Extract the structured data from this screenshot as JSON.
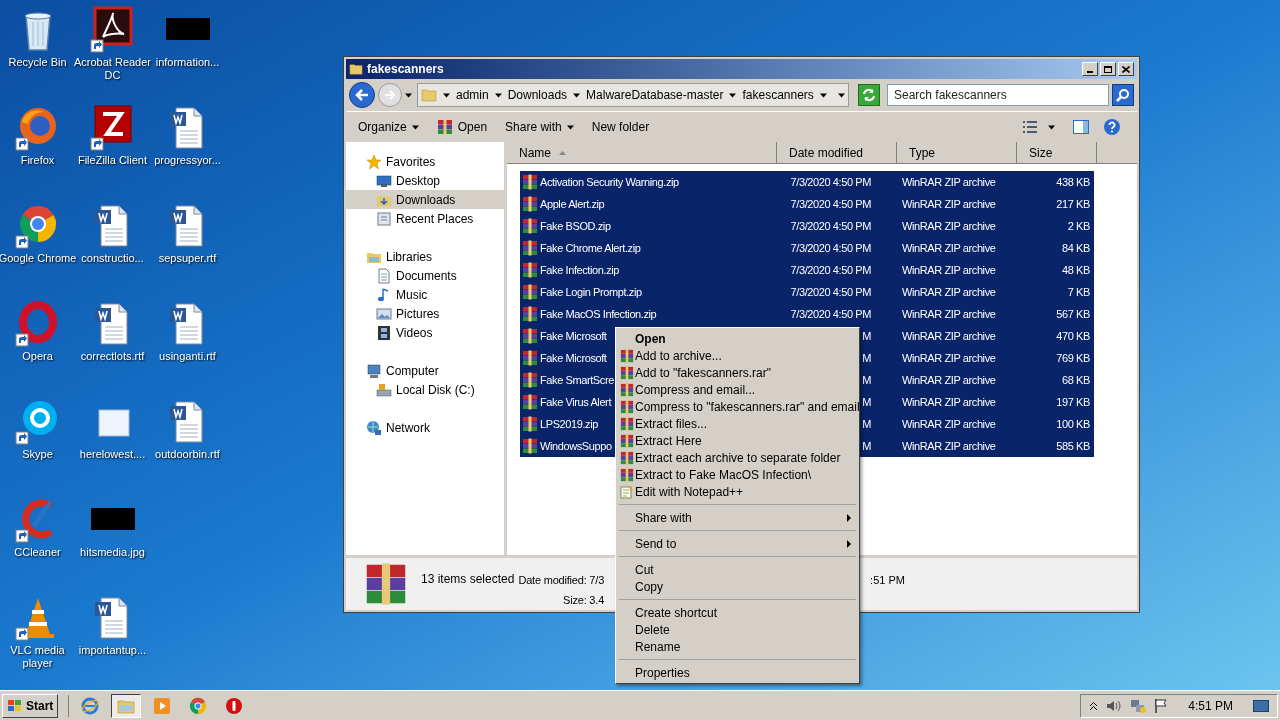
{
  "desktop": {
    "icons": [
      {
        "label": "Recycle Bin",
        "kind": "recycle",
        "shortcut": false
      },
      {
        "label": "Firefox",
        "kind": "firefox",
        "shortcut": true
      },
      {
        "label": "Google Chrome",
        "kind": "chrome",
        "shortcut": true
      },
      {
        "label": "Opera",
        "kind": "opera",
        "shortcut": true
      },
      {
        "label": "Skype",
        "kind": "skype",
        "shortcut": true
      },
      {
        "label": "CCleaner",
        "kind": "ccleaner",
        "shortcut": true
      },
      {
        "label": "VLC media player",
        "kind": "vlc",
        "shortcut": true
      },
      {
        "label": "Acrobat Reader DC",
        "kind": "acrobat",
        "shortcut": true
      },
      {
        "label": "FileZilla Client",
        "kind": "filezilla",
        "shortcut": true
      },
      {
        "label": "constructio...",
        "kind": "word",
        "shortcut": false
      },
      {
        "label": "correctlots.rtf",
        "kind": "word",
        "shortcut": false
      },
      {
        "label": "herelowest....",
        "kind": "blank",
        "shortcut": false
      },
      {
        "label": "hitsmedia.jpg",
        "kind": "black",
        "shortcut": false
      },
      {
        "label": "importantup...",
        "kind": "word",
        "shortcut": false
      },
      {
        "label": "information...",
        "kind": "black",
        "shortcut": false
      },
      {
        "label": "progressyor...",
        "kind": "word",
        "shortcut": false
      },
      {
        "label": "sepsuper.rtf",
        "kind": "word",
        "shortcut": false
      },
      {
        "label": "usinganti.rtf",
        "kind": "word",
        "shortcut": false
      },
      {
        "label": "outdoorbin.rtf",
        "kind": "word",
        "shortcut": false
      }
    ]
  },
  "window": {
    "title": "fakescanners",
    "breadcrumb": [
      "admin",
      "Downloads",
      "MalwareDatabase-master",
      "fakescanners"
    ],
    "search": {
      "placeholder": "Search fakescanners"
    },
    "toolbar": [
      {
        "label": "Organize",
        "kind": "menu"
      },
      {
        "label": "Open",
        "kind": "archive"
      },
      {
        "label": "Share with",
        "kind": "menu"
      },
      {
        "label": "New folder",
        "kind": "plain"
      }
    ],
    "nav": [
      {
        "label": "Favorites",
        "kind": "star",
        "selected": false,
        "children": [
          {
            "label": "Desktop",
            "kind": "desktop",
            "selected": false
          },
          {
            "label": "Downloads",
            "kind": "downloads",
            "selected": true
          },
          {
            "label": "Recent Places",
            "kind": "recent",
            "selected": false
          }
        ]
      },
      {
        "label": "Libraries",
        "kind": "library",
        "selected": false,
        "children": [
          {
            "label": "Documents",
            "kind": "documents",
            "selected": false
          },
          {
            "label": "Music",
            "kind": "music",
            "selected": false
          },
          {
            "label": "Pictures",
            "kind": "pictures",
            "selected": false
          },
          {
            "label": "Videos",
            "kind": "videos",
            "selected": false
          }
        ]
      },
      {
        "label": "Computer",
        "kind": "computer",
        "selected": false,
        "children": [
          {
            "label": "Local Disk (C:)",
            "kind": "disk",
            "selected": false
          }
        ]
      },
      {
        "label": "Network",
        "kind": "network",
        "selected": false
      }
    ],
    "columns": [
      {
        "label": "Name",
        "sorted": true
      },
      {
        "label": "Date modified",
        "sorted": false
      },
      {
        "label": "Type",
        "sorted": false
      },
      {
        "label": "Size",
        "sorted": false
      }
    ],
    "files": [
      {
        "name": "Activation Security Warning.zip",
        "date": "7/3/2020 4:50 PM",
        "type": "WinRAR ZIP archive",
        "size": "438 KB",
        "selected": true
      },
      {
        "name": "Apple Alert.zip",
        "date": "7/3/2020 4:50 PM",
        "type": "WinRAR ZIP archive",
        "size": "217 KB",
        "selected": true
      },
      {
        "name": "Fake BSOD.zip",
        "date": "7/3/2020 4:50 PM",
        "type": "WinRAR ZIP archive",
        "size": "2 KB",
        "selected": true
      },
      {
        "name": "Fake Chrome Alert.zip",
        "date": "7/3/2020 4:50 PM",
        "type": "WinRAR ZIP archive",
        "size": "84 KB",
        "selected": true
      },
      {
        "name": "Fake Infection.zip",
        "date": "7/3/2020 4:50 PM",
        "type": "WinRAR ZIP archive",
        "size": "48 KB",
        "selected": true
      },
      {
        "name": "Fake Login Prompt.zip",
        "date": "7/3/2020 4:50 PM",
        "type": "WinRAR ZIP archive",
        "size": "7 KB",
        "selected": true
      },
      {
        "name": "Fake MacOS Infection.zip",
        "date": "7/3/2020 4:50 PM",
        "type": "WinRAR ZIP archive",
        "size": "567 KB",
        "selected": true
      },
      {
        "name": "Fake Microsoft",
        "date": "M",
        "type": "WinRAR ZIP archive",
        "size": "470 KB",
        "selected": true
      },
      {
        "name": "Fake Microsoft",
        "date": "M",
        "type": "WinRAR ZIP archive",
        "size": "769 KB",
        "selected": true
      },
      {
        "name": "Fake SmartScre",
        "date": "M",
        "type": "WinRAR ZIP archive",
        "size": "68 KB",
        "selected": true
      },
      {
        "name": "Fake Virus Alert",
        "date": "M",
        "type": "WinRAR ZIP archive",
        "size": "197 KB",
        "selected": true
      },
      {
        "name": "LPS2019.zip",
        "date": "M",
        "type": "WinRAR ZIP archive",
        "size": "100 KB",
        "selected": true
      },
      {
        "name": "WindowsSuppo",
        "date": "M",
        "type": "WinRAR ZIP archive",
        "size": "585 KB",
        "selected": true
      }
    ],
    "status": {
      "count": "13 items selected",
      "date": "Date modified: 7/3",
      "size": "Size: 3.4",
      "tail": ":51 PM"
    }
  },
  "context_menu": [
    {
      "label": "Open",
      "kind": "default"
    },
    {
      "label": "Add to archive...",
      "kind": "archive"
    },
    {
      "label": "Add to \"fakescanners.rar\"",
      "kind": "archive"
    },
    {
      "label": "Compress and email...",
      "kind": "archive"
    },
    {
      "label": "Compress to \"fakescanners.rar\" and email",
      "kind": "archive"
    },
    {
      "label": "Extract files...",
      "kind": "archive"
    },
    {
      "label": "Extract Here",
      "kind": "archive"
    },
    {
      "label": "Extract each archive to separate folder",
      "kind": "archive"
    },
    {
      "label": "Extract to Fake MacOS Infection\\",
      "kind": "archive"
    },
    {
      "label": "Edit with Notepad++",
      "kind": "notepad"
    },
    {
      "kind": "separator"
    },
    {
      "label": "Share with",
      "kind": "submenu"
    },
    {
      "kind": "separator"
    },
    {
      "label": "Send to",
      "kind": "submenu"
    },
    {
      "kind": "separator"
    },
    {
      "label": "Cut",
      "kind": "plain"
    },
    {
      "label": "Copy",
      "kind": "plain"
    },
    {
      "kind": "separator"
    },
    {
      "label": "Create shortcut",
      "kind": "plain"
    },
    {
      "label": "Delete",
      "kind": "plain"
    },
    {
      "label": "Rename",
      "kind": "plain"
    },
    {
      "kind": "separator"
    },
    {
      "label": "Properties",
      "kind": "plain"
    }
  ],
  "taskbar": {
    "start": "Start",
    "apps": [
      {
        "kind": "ie",
        "active": false
      },
      {
        "kind": "explorer",
        "active": true
      },
      {
        "kind": "media",
        "active": false
      },
      {
        "kind": "chrome",
        "active": false
      },
      {
        "kind": "stop",
        "active": false
      }
    ],
    "clock": "4:51 PM"
  }
}
